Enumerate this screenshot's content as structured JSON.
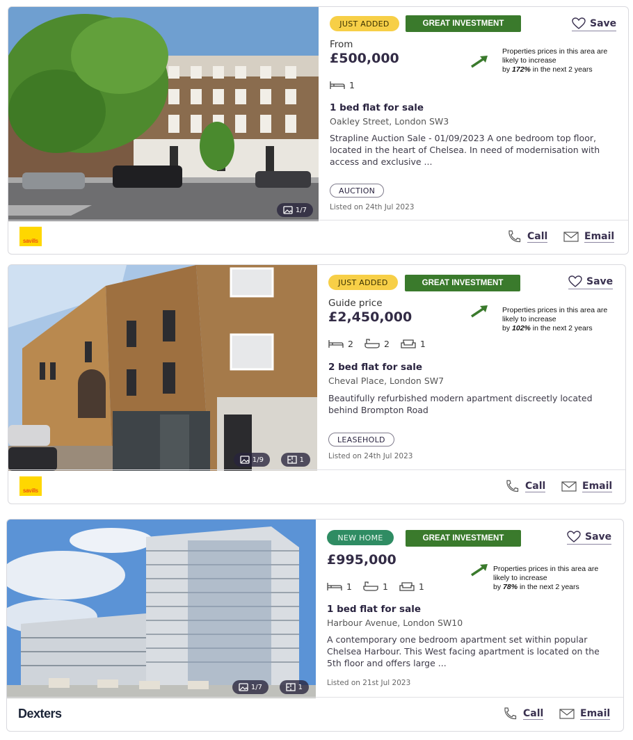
{
  "listings": [
    {
      "tag": "JUST ADDED",
      "investment": "GREAT INVESTMENT",
      "save_label": "Save",
      "price_label": "From",
      "price": "£500,000",
      "note_line1": "Properties prices in this area are likely to increase",
      "note_by": "by ",
      "note_pct": "172%",
      "note_tail": " in the next  2 years",
      "beds": "1",
      "title": "1 bed flat for sale",
      "address": "Oakley Street, London SW3",
      "description": "Strapline Auction Sale - 01/09/2023 A one bedroom top floor, located in the heart of Chelsea. In need of modernisation with access and exclusive ...",
      "pill": "AUCTION",
      "listed": "Listed on 24th Jul 2023",
      "photo_count": "1/7",
      "agent": "savills",
      "call_label": "Call",
      "email_label": "Email"
    },
    {
      "tag": "JUST ADDED",
      "investment": "GREAT INVESTMENT",
      "save_label": "Save",
      "price_label": "Guide price",
      "price": "£2,450,000",
      "note_line1": "Properties prices in this area are likely to increase",
      "note_by": "by ",
      "note_pct": "102%",
      "note_tail": " in the next  2 years",
      "beds": "2",
      "baths": "2",
      "receptions": "1",
      "title": "2 bed flat for sale",
      "address": "Cheval Place, London SW7",
      "description": "Beautifully refurbished modern apartment discreetly located behind Brompton Road",
      "pill": "LEASEHOLD",
      "listed": "Listed on 24th Jul 2023",
      "photo_count": "1/9",
      "floorplan_count": "1",
      "agent": "savills",
      "call_label": "Call",
      "email_label": "Email"
    },
    {
      "tag": "NEW HOME",
      "investment": "GREAT INVESTMENT",
      "save_label": "Save",
      "price": "£995,000",
      "note_line1": "Properties prices in this area are likely to increase",
      "note_by": "by ",
      "note_pct": "78%",
      "note_tail": " in the next  2 years",
      "beds": "1",
      "baths": "1",
      "receptions": "1",
      "title": "1 bed flat for sale",
      "address": "Harbour Avenue, London SW10",
      "description": "A contemporary one bedroom apartment set within popular Chelsea Harbour. This West facing apartment is located on the 5th floor and offers large ...",
      "listed": "Listed on 21st Jul 2023",
      "photo_count": "1/7",
      "floorplan_count": "1",
      "agent": "Dexters",
      "call_label": "Call",
      "email_label": "Email"
    }
  ],
  "colors": {
    "investment": "#3a7a2c",
    "just_added": "#f7cf47",
    "new_home": "#2f8c63",
    "savills_yellow": "#ffd700"
  }
}
